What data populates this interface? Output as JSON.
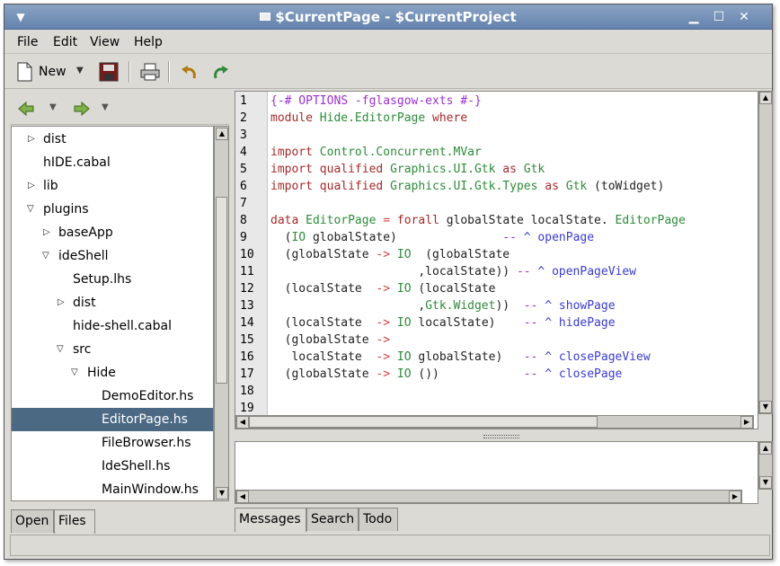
{
  "window": {
    "title": "$CurrentPage - $CurrentProject"
  },
  "menubar": [
    {
      "label": "File"
    },
    {
      "label": "Edit"
    },
    {
      "label": "View"
    },
    {
      "label": "Help"
    }
  ],
  "toolbar": {
    "new_label": "New"
  },
  "tree": {
    "rows": [
      {
        "label": "dist"
      },
      {
        "label": "hIDE.cabal"
      },
      {
        "label": "lib"
      },
      {
        "label": "plugins"
      },
      {
        "label": "baseApp"
      },
      {
        "label": "ideShell"
      },
      {
        "label": "Setup.lhs"
      },
      {
        "label": "dist"
      },
      {
        "label": "hide-shell.cabal"
      },
      {
        "label": "src"
      },
      {
        "label": "Hide"
      },
      {
        "label": "DemoEditor.hs"
      },
      {
        "label": "EditorPage.hs"
      },
      {
        "label": "FileBrowser.hs"
      },
      {
        "label": "IdeShell.hs"
      },
      {
        "label": "MainWindow.hs"
      }
    ],
    "selected": "EditorPage.hs"
  },
  "left_tabs": [
    {
      "label": "Open"
    },
    {
      "label": "Files"
    }
  ],
  "editor": {
    "line_numbers": [
      "1",
      "2",
      "3",
      "4",
      "5",
      "6",
      "7",
      "8",
      "9",
      "10",
      "11",
      "12",
      "13",
      "14",
      "15",
      "16",
      "17",
      "18",
      "19"
    ]
  },
  "bottom_tabs": [
    {
      "label": "Messages"
    },
    {
      "label": "Search"
    },
    {
      "label": "Todo"
    }
  ],
  "colors": {
    "selection": "#4b6983",
    "titlebar": "#6483ad",
    "keyword": "#a52a2a",
    "type": "#2e8b3a",
    "comment": "#9b30d0",
    "doc": "#3a3ad0"
  }
}
